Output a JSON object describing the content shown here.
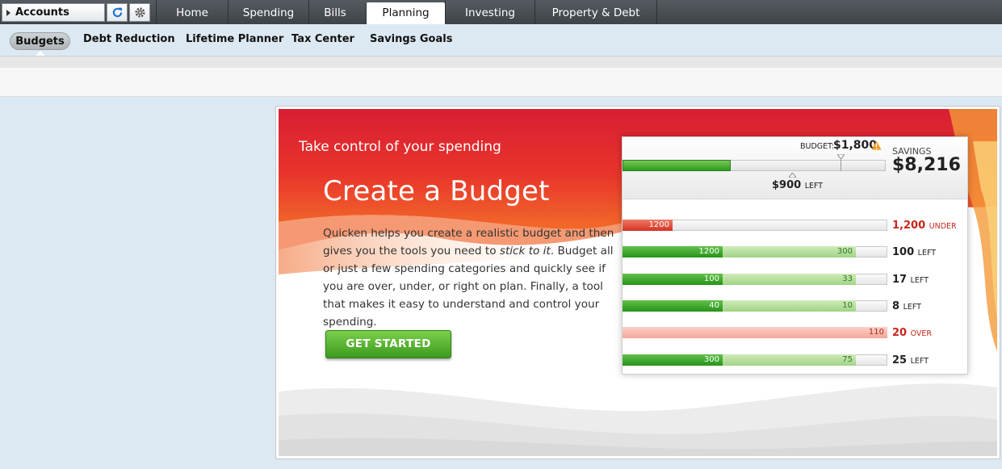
{
  "nav": {
    "accounts_label": "Accounts",
    "tabs": [
      {
        "label": "Home"
      },
      {
        "label": "Spending"
      },
      {
        "label": "Bills"
      },
      {
        "label": "Planning"
      },
      {
        "label": "Investing"
      },
      {
        "label": "Property & Debt"
      }
    ],
    "active_tab": "Planning"
  },
  "subnav": {
    "items": [
      {
        "label": "Budgets"
      },
      {
        "label": "Debt Reduction"
      },
      {
        "label": "Lifetime Planner"
      },
      {
        "label": "Tax Center"
      },
      {
        "label": "Savings Goals"
      }
    ],
    "active": "Budgets"
  },
  "banner": {
    "tagline": "Take control of your spending",
    "headline": "Create a Budget",
    "desc_part1": "Quicken helps you create a realistic budget and then gives you the tools you need to ",
    "desc_em": "stick to it",
    "desc_part2": ". Budget all or just a few spending categories and quickly see if you are over, under, or right on plan. Finally, a tool that makes it easy to understand and control your spending.",
    "cta_label": "GET STARTED"
  },
  "card": {
    "budget_label": "BUDGET:",
    "budget_amount": "$1,800",
    "savings_label": "SAVINGS",
    "savings_amount": "$8,216",
    "left_amount": "$900",
    "left_word": "LEFT",
    "main_fill_fraction": 0.41,
    "rows": [
      {
        "spent_label": "1200",
        "remain_label": "",
        "value": "1,200",
        "word": "UNDER",
        "red": true
      },
      {
        "spent_label": "1200",
        "remain_label": "300",
        "value": "100",
        "word": "LEFT",
        "red": false
      },
      {
        "spent_label": "100",
        "remain_label": "33",
        "value": "17",
        "word": "LEFT",
        "red": false
      },
      {
        "spent_label": "40",
        "remain_label": "10",
        "value": "8",
        "word": "LEFT",
        "red": false
      },
      {
        "spent_label": "",
        "remain_label": "110",
        "value": "20",
        "word": "OVER",
        "red": true
      },
      {
        "spent_label": "300",
        "remain_label": "75",
        "value": "25",
        "word": "LEFT",
        "red": false
      }
    ]
  },
  "colors": {
    "accent_red": "#c8261a",
    "accent_green": "#2e9a1f",
    "nav_dark": "#45494d"
  }
}
